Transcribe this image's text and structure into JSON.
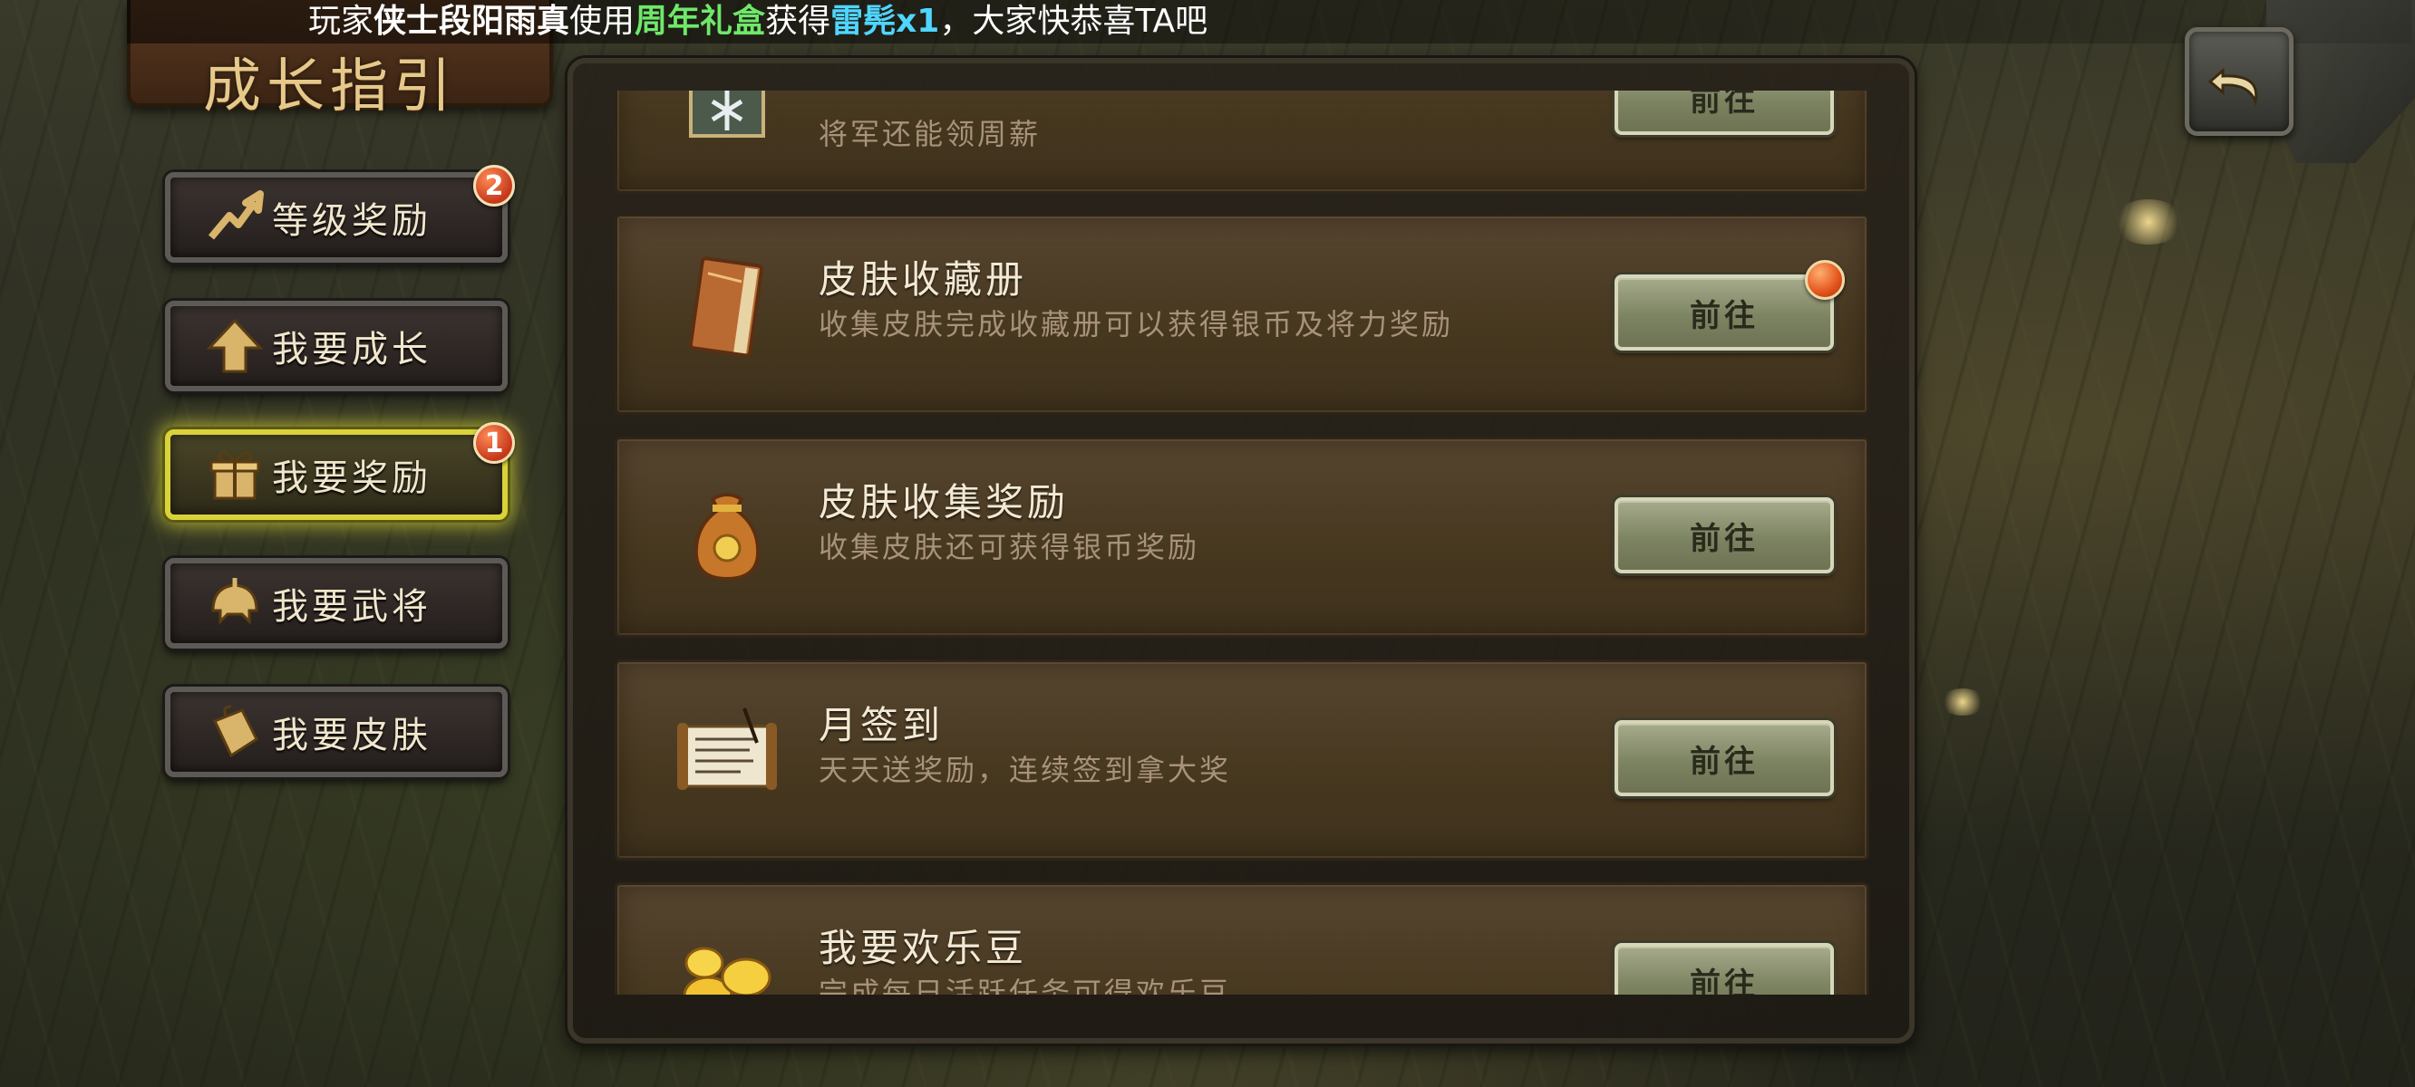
{
  "banner": {
    "prefix": "玩家",
    "player_name": "侠士段阳雨真",
    "used": "使用",
    "gift": "周年礼盒",
    "obtained": "获得",
    "item": "雷髡x1",
    "suffix": "，大家快恭喜TA吧"
  },
  "header": {
    "title": "成长指引"
  },
  "nav": {
    "items": [
      {
        "label": "等级奖励",
        "icon": "trend-arrow-icon",
        "badge": "2"
      },
      {
        "label": "我要成长",
        "icon": "up-arrow-icon"
      },
      {
        "label": "我要奖励",
        "icon": "gift-icon",
        "badge": "1",
        "active": true
      },
      {
        "label": "我要武将",
        "icon": "helmet-icon"
      },
      {
        "label": "我要皮肤",
        "icon": "skin-bag-icon"
      }
    ]
  },
  "list": {
    "items": [
      {
        "title": "",
        "desc": "将军还能领周薪",
        "button": "前往",
        "icon": "banner-icon"
      },
      {
        "title": "皮肤收藏册",
        "desc": "收集皮肤完成收藏册可以获得银币及将力奖励",
        "button": "前往",
        "icon": "book-icon",
        "notify": true
      },
      {
        "title": "皮肤收集奖励",
        "desc": "收集皮肤还可获得银币奖励",
        "button": "前往",
        "icon": "money-bag-icon"
      },
      {
        "title": "月签到",
        "desc": "天天送奖励，连续签到拿大奖",
        "button": "前往",
        "icon": "scroll-icon"
      },
      {
        "title": "我要欢乐豆",
        "desc": "完成每日活跃任务可得欢乐豆",
        "button": "前往",
        "icon": "gold-beans-icon"
      }
    ]
  },
  "colors": {
    "accent_active": "#d9d23a",
    "badge": "#c5391a",
    "button": "#7d8462",
    "gift_text": "#6fe86a",
    "item_text": "#4fd6ff"
  }
}
